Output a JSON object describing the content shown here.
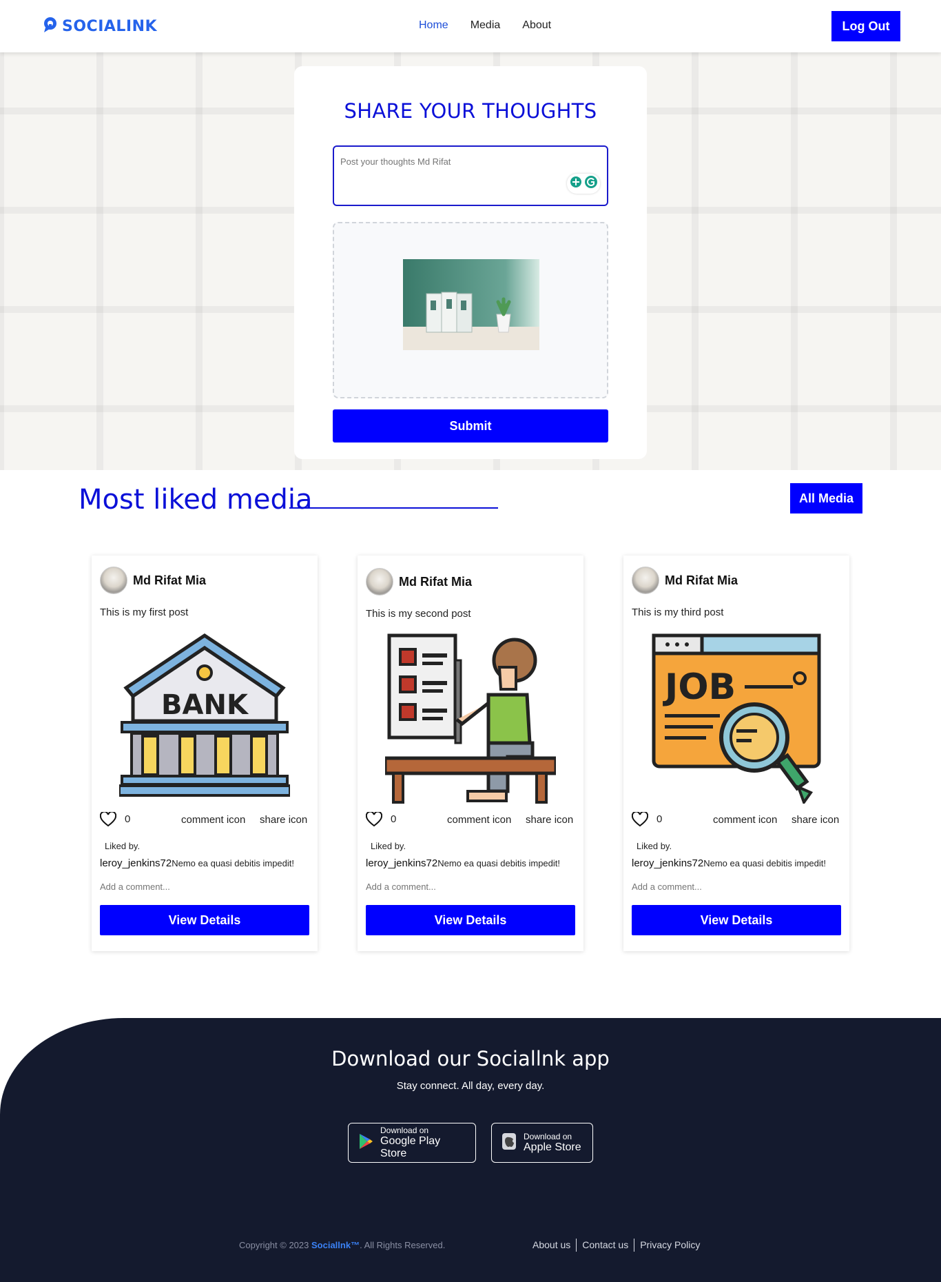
{
  "brand": {
    "name": "SOCIALINK",
    "color": "#2563eb"
  },
  "nav": {
    "links": [
      {
        "label": "Home"
      },
      {
        "label": "Media"
      },
      {
        "label": "About"
      }
    ],
    "active": "Home",
    "logout_label": "Log Out"
  },
  "share": {
    "title": "SHARE YOUR THOUGHTS",
    "placeholder": "Post your thoughts Md Rifat",
    "submit_label": "Submit"
  },
  "most_liked": {
    "title": "Most liked media",
    "all_media_label": "All Media"
  },
  "posts": [
    {
      "author": "Md Rifat Mia",
      "text": "This is my first post",
      "image_icon": "bank-icon",
      "likes": "0",
      "comment_label": "comment icon",
      "share_label": "share icon",
      "liked_by_label": "Liked by.",
      "liker": "leroy_jenkins72",
      "liker_comment": "Nemo ea quasi debitis impedit!",
      "add_comment_placeholder": "Add a comment...",
      "details_label": "View Details"
    },
    {
      "author": "Md Rifat Mia",
      "text": "This is my second post",
      "image_icon": "person-at-desk-icon",
      "likes": "0",
      "comment_label": "comment icon",
      "share_label": "share icon",
      "liked_by_label": "Liked by.",
      "liker": "leroy_jenkins72",
      "liker_comment": "Nemo ea quasi debitis impedit!",
      "add_comment_placeholder": "Add a comment...",
      "details_label": "View Details"
    },
    {
      "author": "Md Rifat Mia",
      "text": "This is my third post",
      "image_icon": "job-search-icon",
      "likes": "0",
      "comment_label": "comment icon",
      "share_label": "share icon",
      "liked_by_label": "Liked by.",
      "liker": "leroy_jenkins72",
      "liker_comment": "Nemo ea quasi debitis impedit!",
      "add_comment_placeholder": "Add a comment...",
      "details_label": "View Details"
    }
  ],
  "footer": {
    "app_title": "Download our Sociallnk app",
    "app_subtitle": "Stay connect. All day, every day.",
    "google": {
      "small": "Download on",
      "big": "Google Play Store"
    },
    "apple": {
      "small": "Download on",
      "big": "Apple Store"
    },
    "copyright_prefix": "Copyright © 2023",
    "copyright_brand": "Sociallnk™",
    "copyright_suffix": ". All Rights Reserved.",
    "links": [
      {
        "label": "About us"
      },
      {
        "label": "Contact us"
      },
      {
        "label": "Privacy Policy"
      }
    ]
  },
  "colors": {
    "primary": "#0000ff",
    "heading": "#0b10d8",
    "footer_bg": "#141a2e"
  }
}
